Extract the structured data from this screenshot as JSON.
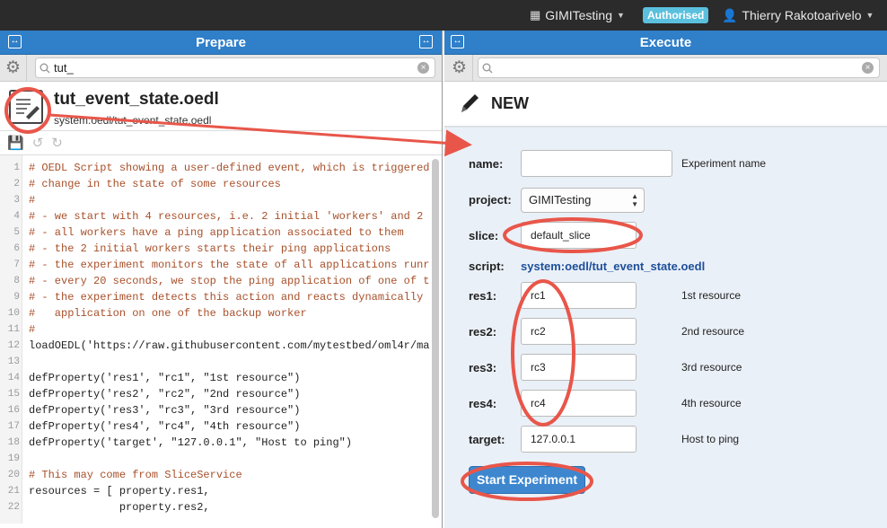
{
  "topbar": {
    "project": "GIMITesting",
    "status_badge": "Authorised",
    "user": "Thierry Rakotoarivelo"
  },
  "prepare": {
    "title": "Prepare",
    "search_value": "tut_",
    "file_name": "tut_event_state.oedl",
    "file_path": "system:oedl/tut_event_state.oedl",
    "code_lines": [
      {
        "n": "1",
        "text": "# OEDL Script showing a user-defined event, which is triggered",
        "kind": "cmt"
      },
      {
        "n": "2",
        "text": "# change in the state of some resources",
        "kind": "cmt"
      },
      {
        "n": "3",
        "text": "#",
        "kind": "cmt"
      },
      {
        "n": "4",
        "text": "# - we start with 4 resources, i.e. 2 initial 'workers' and 2",
        "kind": "cmt"
      },
      {
        "n": "5",
        "text": "# - all workers have a ping application associated to them",
        "kind": "cmt"
      },
      {
        "n": "6",
        "text": "# - the 2 initial workers starts their ping applications",
        "kind": "cmt"
      },
      {
        "n": "7",
        "text": "# - the experiment monitors the state of all applications runr",
        "kind": "cmt"
      },
      {
        "n": "8",
        "text": "# - every 20 seconds, we stop the ping application of one of t",
        "kind": "cmt"
      },
      {
        "n": "9",
        "text": "# - the experiment detects this action and reacts dynamically",
        "kind": "cmt"
      },
      {
        "n": "10",
        "text": "#   application on one of the backup worker",
        "kind": "cmt"
      },
      {
        "n": "11",
        "text": "#",
        "kind": "cmt"
      },
      {
        "n": "12",
        "text": "loadOEDL('https://raw.githubusercontent.com/mytestbed/oml4r/ma",
        "kind": "plain"
      },
      {
        "n": "13",
        "text": "",
        "kind": "plain"
      },
      {
        "n": "14",
        "text": "defProperty('res1', \"rc1\", \"1st resource\")",
        "kind": "plain"
      },
      {
        "n": "15",
        "text": "defProperty('res2', \"rc2\", \"2nd resource\")",
        "kind": "plain"
      },
      {
        "n": "16",
        "text": "defProperty('res3', \"rc3\", \"3rd resource\")",
        "kind": "plain"
      },
      {
        "n": "17",
        "text": "defProperty('res4', \"rc4\", \"4th resource\")",
        "kind": "plain"
      },
      {
        "n": "18",
        "text": "defProperty('target', \"127.0.0.1\", \"Host to ping\")",
        "kind": "plain"
      },
      {
        "n": "19",
        "text": "",
        "kind": "plain"
      },
      {
        "n": "20",
        "text": "# This may come from SliceService",
        "kind": "cmt"
      },
      {
        "n": "21",
        "text": "resources = [ property.res1,",
        "kind": "plain"
      },
      {
        "n": "22",
        "text": "              property.res2,",
        "kind": "plain"
      }
    ]
  },
  "execute": {
    "title": "Execute",
    "search_value": "",
    "new_label": "NEW",
    "labels": {
      "name": "name:",
      "project": "project:",
      "slice": "slice:",
      "script": "script:",
      "res1": "res1:",
      "res2": "res2:",
      "res3": "res3:",
      "res4": "res4:",
      "target": "target:"
    },
    "values": {
      "name": "",
      "project": "GIMITesting",
      "slice": "default_slice",
      "script": "system:oedl/tut_event_state.oedl",
      "res1": "rc1",
      "res2": "rc2",
      "res3": "rc3",
      "res4": "rc4",
      "target": "127.0.0.1"
    },
    "hints": {
      "name": "Experiment name",
      "res1": "1st resource",
      "res2": "2nd resource",
      "res3": "3rd resource",
      "res4": "4th resource",
      "target": "Host to ping"
    },
    "start_button": "Start Experiment"
  },
  "colors": {
    "header_blue": "#2f7fc9",
    "annotation_red": "#e8564a",
    "form_bg": "#eaf0f7",
    "badge": "#5bc0de"
  }
}
